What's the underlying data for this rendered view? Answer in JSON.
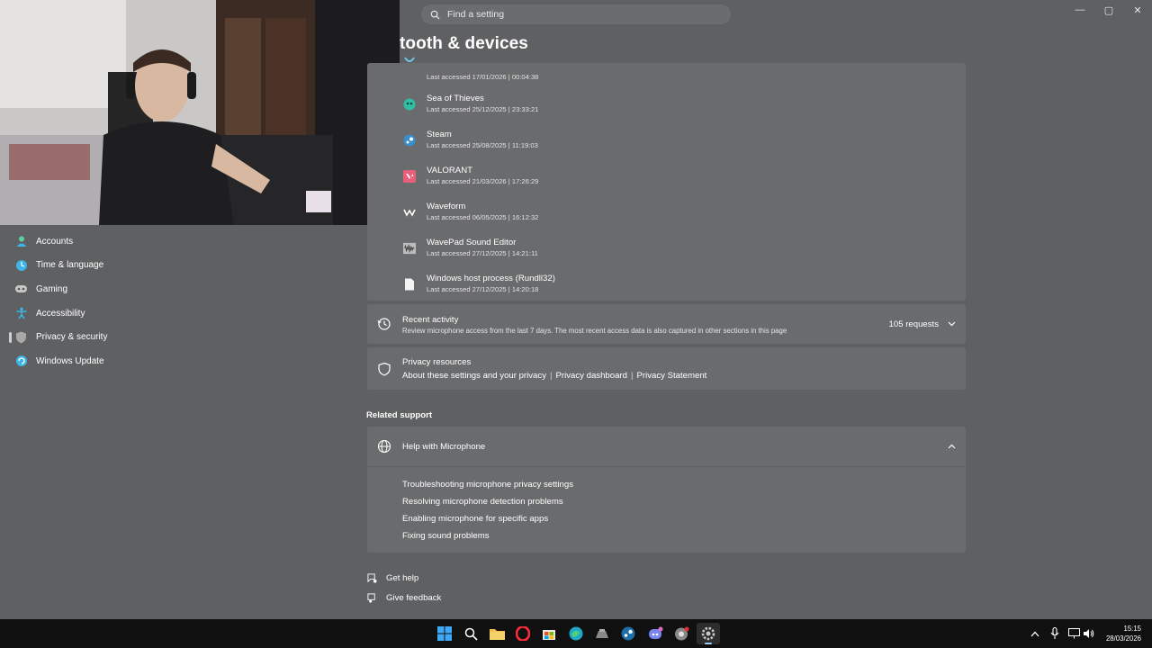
{
  "search": {
    "placeholder": "Find a setting"
  },
  "window_controls": {
    "minimize": "—",
    "maximize": "▢",
    "close": "✕"
  },
  "page": {
    "title": "tooth & devices"
  },
  "sidebar": {
    "items": [
      {
        "label": "Accounts",
        "icon": "accounts-icon"
      },
      {
        "label": "Time & language",
        "icon": "time-language-icon"
      },
      {
        "label": "Gaming",
        "icon": "gaming-icon"
      },
      {
        "label": "Accessibility",
        "icon": "accessibility-icon"
      },
      {
        "label": "Privacy & security",
        "icon": "shield-icon",
        "active": true
      },
      {
        "label": "Windows Update",
        "icon": "windows-update-icon"
      }
    ]
  },
  "apps": [
    {
      "name": "",
      "date": "Last accessed 17/01/2026  |  00:04:38",
      "icon": "app-icon"
    },
    {
      "name": "Sea of Thieves",
      "date": "Last accessed 25/12/2025  |  23:33:21",
      "icon": "sea-of-thieves-icon"
    },
    {
      "name": "Steam",
      "date": "Last accessed 25/08/2025  |  11:19:03",
      "icon": "steam-icon"
    },
    {
      "name": "VALORANT",
      "date": "Last accessed 21/03/2026  |  17:26:29",
      "icon": "valorant-icon"
    },
    {
      "name": "Waveform",
      "date": "Last accessed 06/05/2025  |  16:12:32",
      "icon": "waveform-icon"
    },
    {
      "name": "WavePad Sound Editor",
      "date": "Last accessed 27/12/2025  |  14:21:11",
      "icon": "wavepad-icon"
    },
    {
      "name": "Windows host process (Rundll32)",
      "date": "Last accessed 27/12/2025  |  14:20:18",
      "icon": "file-icon"
    }
  ],
  "recent_activity": {
    "title": "Recent activity",
    "description": "Review microphone access from the last 7 days. The most recent access data is also captured in other sections in this page",
    "requests": "105 requests"
  },
  "privacy_resources": {
    "title": "Privacy resources",
    "links": [
      "About these settings and your privacy",
      "Privacy dashboard",
      "Privacy Statement"
    ],
    "separator": "|"
  },
  "related_support": {
    "label": "Related support",
    "help_title": "Help with Microphone",
    "links": [
      "Troubleshooting microphone privacy settings",
      "Resolving microphone detection problems",
      "Enabling microphone for specific apps",
      "Fixing sound problems"
    ]
  },
  "footer": {
    "get_help": "Get help",
    "give_feedback": "Give feedback"
  },
  "taskbar": {
    "apps": [
      "start-icon",
      "search-icon",
      "file-explorer-icon",
      "opera-icon",
      "store-icon",
      "edge-icon",
      "app-icon",
      "steam-icon",
      "discord-icon",
      "chrome-icon",
      "settings-icon"
    ],
    "clock_time": "15:15",
    "clock_date": "28/03/2026"
  }
}
